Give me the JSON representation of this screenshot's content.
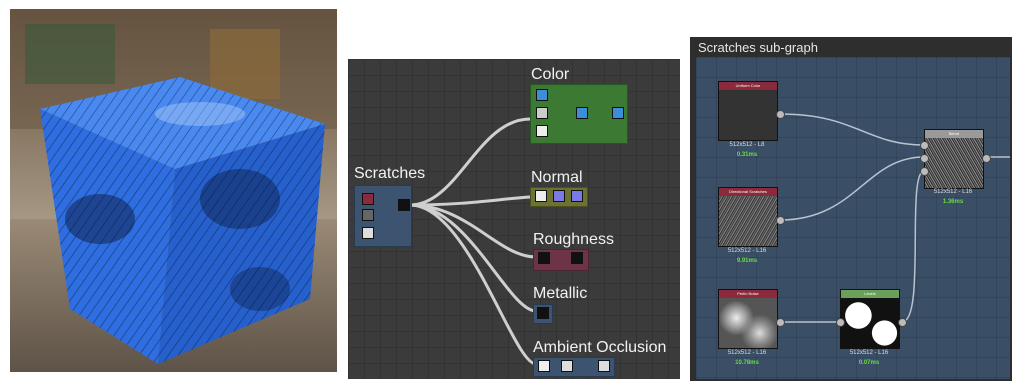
{
  "graph": {
    "frames": [
      {
        "id": "scratches",
        "label": "Scratches",
        "color": "#3c5470"
      },
      {
        "id": "color",
        "label": "Color",
        "color": "#3c7a34"
      },
      {
        "id": "normal",
        "label": "Normal",
        "color": "#6d7230"
      },
      {
        "id": "roughness",
        "label": "Roughness",
        "color": "#6d3448"
      },
      {
        "id": "metallic",
        "label": "Metallic",
        "color": "#3c5470"
      },
      {
        "id": "ao",
        "label": "Ambient Occlusion",
        "color": "#3c5470"
      }
    ]
  },
  "subgraph": {
    "title": "Scratches sub-graph",
    "nodes": [
      {
        "id": "uniform",
        "header": "Uniform Color",
        "header_color": "#8b2a3a",
        "resolution": "512x512 - L8",
        "time": "0.31ms"
      },
      {
        "id": "directional",
        "header": "Directional Scratches",
        "header_color": "#8b2a3a",
        "resolution": "512x512 - L16",
        "time": "9.91ms"
      },
      {
        "id": "perlin",
        "header": "Perlin Noise",
        "header_color": "#8b2a3a",
        "resolution": "512x512 - L16",
        "time": "10.78ms"
      },
      {
        "id": "levels",
        "header": "Levels",
        "header_color": "#6aa05a",
        "resolution": "512x512 - L16",
        "time": "0.07ms"
      },
      {
        "id": "blend",
        "header": "Blend",
        "header_color": "#9a9a9a",
        "resolution": "512x512 - L16",
        "time": "1.36ms"
      }
    ]
  },
  "colors": {
    "cube_blue": "#2f6ee0",
    "graph_bg": "#3b3b3b",
    "subgraph_bg": "#3a4f66",
    "time_green": "#66dd44"
  }
}
